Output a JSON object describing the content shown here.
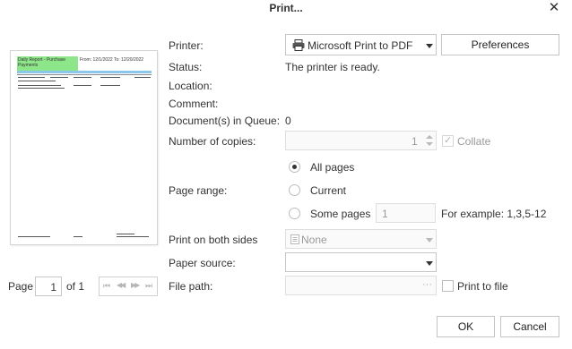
{
  "dialog": {
    "title": "Print...",
    "close_glyph": "✕"
  },
  "printer": {
    "label": "Printer:",
    "selected": "Microsoft Print to PDF",
    "preferences_label": "Preferences"
  },
  "status": {
    "label": "Status:",
    "value": "The printer is ready."
  },
  "location": {
    "label": "Location:"
  },
  "comment": {
    "label": "Comment:"
  },
  "queue": {
    "label": "Document(s) in Queue:",
    "value": "0"
  },
  "copies": {
    "label": "Number of copies:",
    "value": "1",
    "collate_label": "Collate"
  },
  "page_range": {
    "label": "Page range:",
    "all_pages": "All pages",
    "current": "Current",
    "some_pages": "Some pages",
    "some_pages_value": "1",
    "example": "For example: 1,3,5-12"
  },
  "duplex": {
    "label": "Print on both sides",
    "value": "None"
  },
  "paper_source": {
    "label": "Paper source:",
    "value": ""
  },
  "file_path": {
    "label": "File path:",
    "value": "",
    "browse_glyph": "···",
    "print_to_file_label": "Print to file"
  },
  "preview": {
    "page_label": "Page",
    "page_value": "1",
    "of_label": "of 1",
    "header_title": "Daily Report - Purchase Payments",
    "header_range": "From: 12/1/2022  To: 12/20/2022",
    "accent_color": "#8ee68a",
    "nav_glyphs": [
      "⏮",
      "◀◀",
      "▶▶",
      "⏭"
    ]
  },
  "footer": {
    "ok_label": "OK",
    "cancel_label": "Cancel"
  }
}
